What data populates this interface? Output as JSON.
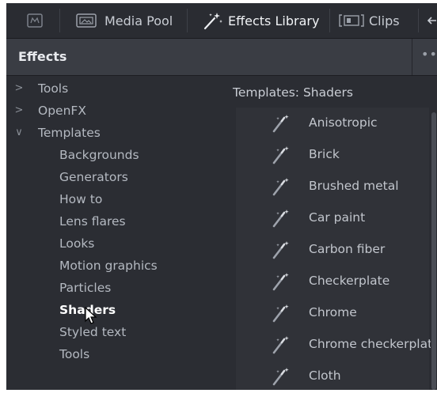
{
  "toolbar": {
    "items": [
      {
        "label": "",
        "icon": "media-tile-icon"
      },
      {
        "label": "Media Pool",
        "icon": "media-pool-icon"
      },
      {
        "label": "Effects Library",
        "icon": "magic-wand-icon",
        "active": true
      },
      {
        "label": "Clips",
        "icon": "clips-icon"
      }
    ]
  },
  "header": {
    "title": "Effects",
    "more": "••"
  },
  "tree": {
    "items": [
      {
        "label": "Tools",
        "chevron": ">",
        "level": 0
      },
      {
        "label": "OpenFX",
        "chevron": ">",
        "level": 0
      },
      {
        "label": "Templates",
        "chevron": "∨",
        "level": 0
      },
      {
        "label": "Backgrounds",
        "level": 1
      },
      {
        "label": "Generators",
        "level": 1
      },
      {
        "label": "How to",
        "level": 1
      },
      {
        "label": "Lens flares",
        "level": 1
      },
      {
        "label": "Looks",
        "level": 1
      },
      {
        "label": "Motion graphics",
        "level": 1
      },
      {
        "label": "Particles",
        "level": 1
      },
      {
        "label": "Shaders",
        "level": 1,
        "selected": true
      },
      {
        "label": "Styled text",
        "level": 1
      },
      {
        "label": "Tools",
        "level": 1
      }
    ]
  },
  "panel": {
    "title": "Templates: Shaders",
    "items": [
      {
        "label": "Anisotropic",
        "icon": "shader-wand-icon"
      },
      {
        "label": "Brick",
        "icon": "shader-wand-icon"
      },
      {
        "label": "Brushed metal",
        "icon": "shader-wand-icon"
      },
      {
        "label": "Car paint",
        "icon": "shader-wand-icon"
      },
      {
        "label": "Carbon fiber",
        "icon": "shader-wand-icon"
      },
      {
        "label": "Checkerplate",
        "icon": "shader-wand-icon"
      },
      {
        "label": "Chrome",
        "icon": "shader-wand-icon"
      },
      {
        "label": "Chrome checkerplate",
        "icon": "shader-wand-icon"
      },
      {
        "label": "Cloth",
        "icon": "shader-wand-icon"
      }
    ]
  },
  "colors": {
    "background": "#2b2d33",
    "header": "#3a3d44",
    "text": "#b4b9c1",
    "selected_text": "#ffffff"
  }
}
